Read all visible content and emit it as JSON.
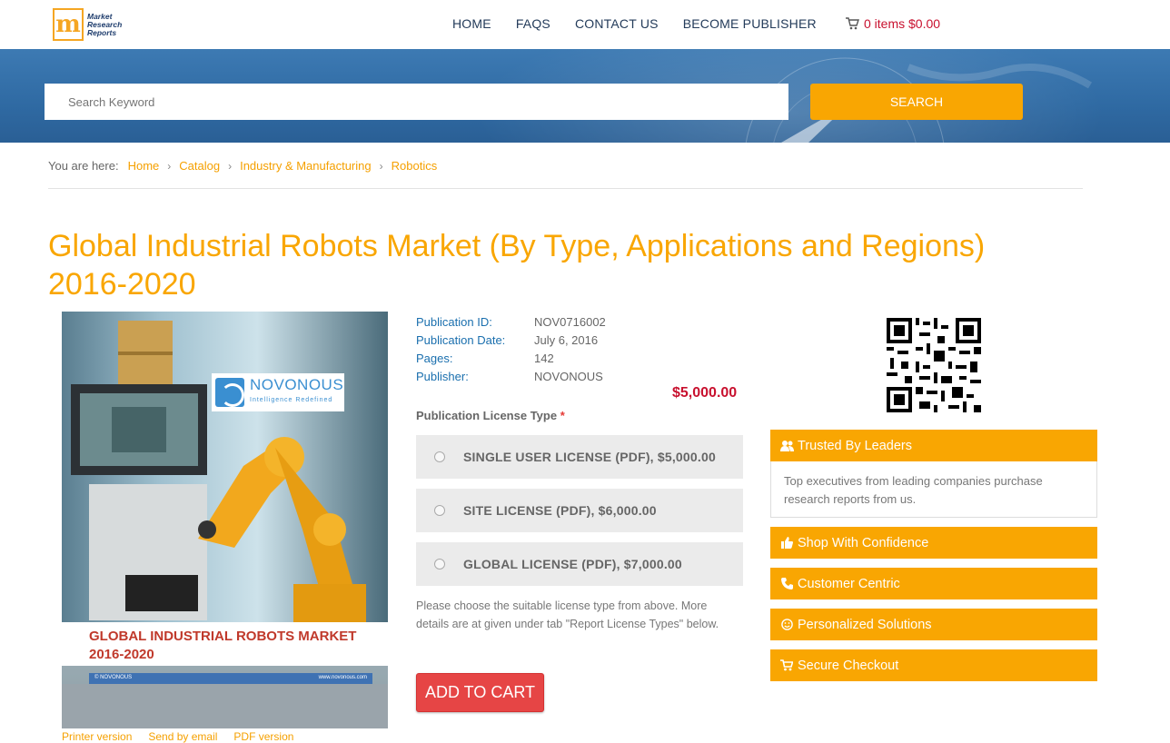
{
  "header": {
    "logo_text": [
      "Market",
      "Research",
      "Reports"
    ],
    "nav": [
      "HOME",
      "FAQS",
      "CONTACT US",
      "BECOME PUBLISHER"
    ],
    "cart": "0 items $0.00"
  },
  "search": {
    "placeholder": "Search Keyword",
    "button": "SEARCH"
  },
  "breadcrumb": {
    "prefix": "You are here:",
    "items": [
      "Home",
      "Catalog",
      "Industry & Manufacturing",
      "Robotics"
    ]
  },
  "title": "Global Industrial Robots Market (By Type, Applications and Regions) 2016-2020",
  "cover": {
    "brand": "NOVONOUS",
    "brand_tagline": "Intelligence Redefined",
    "title_line1": "GLOBAL INDUSTRIAL ROBOTS MARKET",
    "title_line2": "2016-2020",
    "strip_left": "© NOVONOUS",
    "strip_right": "www.novonous.com"
  },
  "below_cover": [
    "Printer version",
    "Send by email",
    "PDF version"
  ],
  "publication": {
    "rows": [
      {
        "label": "Publication ID:",
        "value": "NOV0716002"
      },
      {
        "label": "Publication Date:",
        "value": "July 6, 2016"
      },
      {
        "label": "Pages:",
        "value": "142"
      },
      {
        "label": "Publisher:",
        "value": "NOVONOUS"
      }
    ],
    "price": "$5,000.00"
  },
  "license": {
    "label": "Publication License Type",
    "required_mark": "*",
    "options": [
      "SINGLE USER LICENSE (PDF), $5,000.00",
      "SITE LICENSE (PDF), $6,000.00",
      "GLOBAL LICENSE (PDF), $7,000.00"
    ],
    "note": "Please choose the suitable license type from above. More details are at given under tab \"Report License Types\" below.",
    "add_to_cart": "ADD TO CART"
  },
  "sidebar": {
    "trusted_title": "Trusted By Leaders",
    "trusted_body": "Top executives from leading companies purchase research reports from us.",
    "items": [
      "Shop With Confidence",
      "Customer Centric",
      "Personalized Solutions",
      "Secure Checkout"
    ]
  },
  "colors": {
    "accent": "#f9a602",
    "price": "#c8102e",
    "link": "#1a6fae",
    "cart_button": "#e64545"
  }
}
